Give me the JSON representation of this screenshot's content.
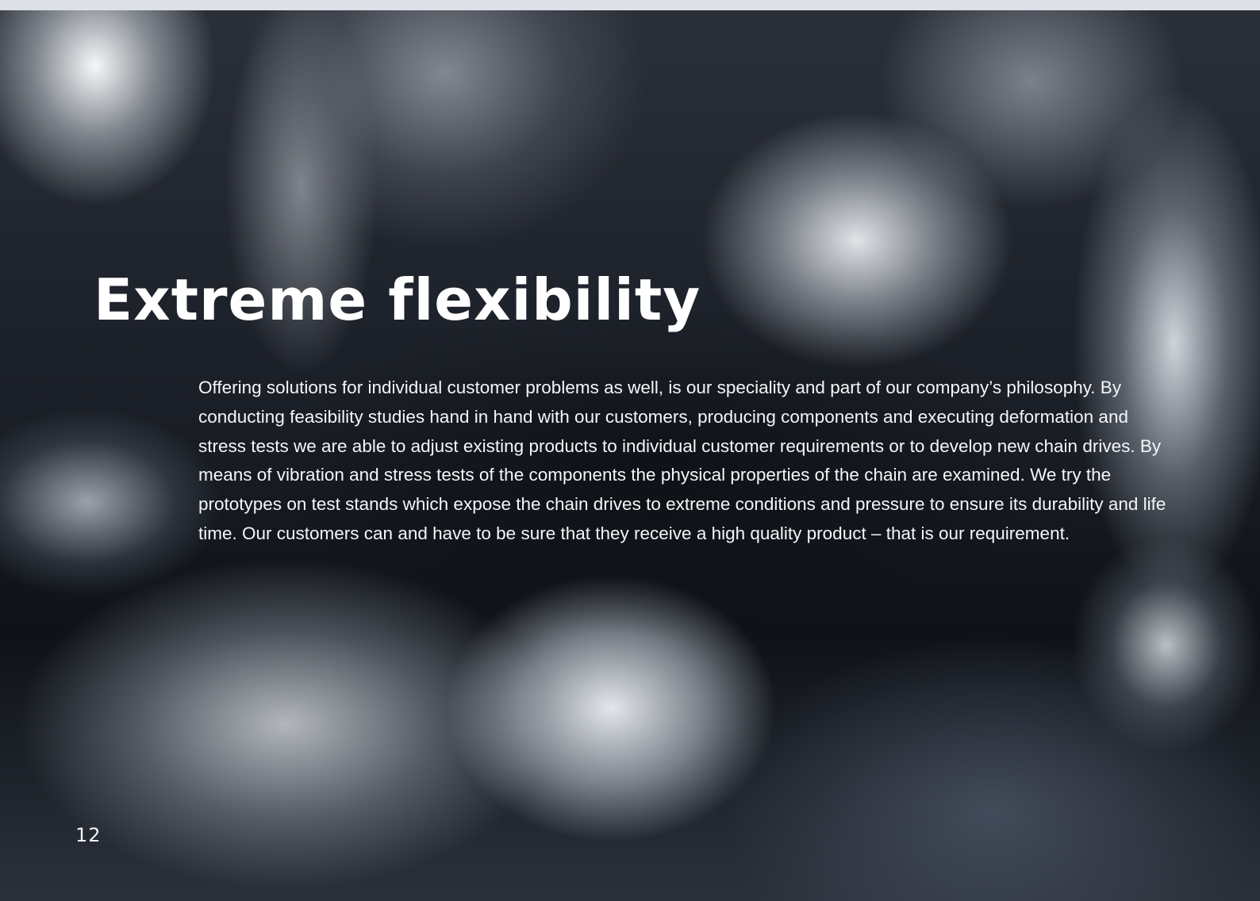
{
  "page": {
    "title": "Extreme flexibility",
    "body": "Offering solutions for individual customer problems as well, is our speciality and part of our company’s philosophy. By conducting feasibility studies hand in hand with our customers, producing components and executing deformation and stress tests we are able to adjust existing products to individual customer requirements or to develop new chain drives. By means of vibration and stress tests of the components the physical properties of the chain are examined. We try the prototypes on test stands which expose the chain drives to extreme conditions and pressure to ensure its durability and life time. Our customers can and have to be sure that they receive a high quality product – that is our requirement.",
    "page_number": "12"
  }
}
